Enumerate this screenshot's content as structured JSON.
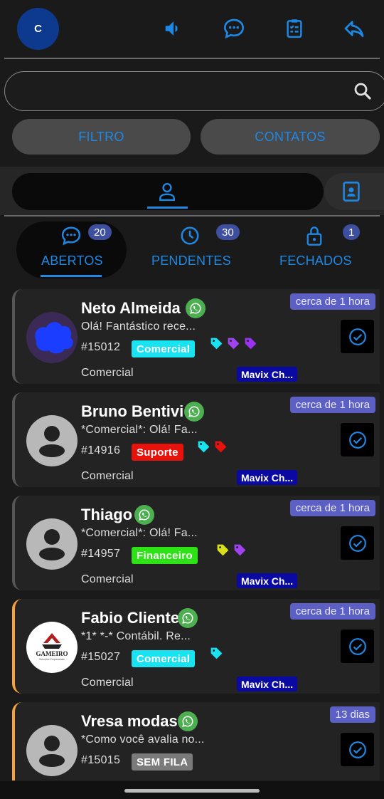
{
  "header": {
    "avatar_initial": "C",
    "icons": [
      "volume-icon",
      "chat-bubble-icon",
      "clipboard-icon",
      "reply-icon"
    ]
  },
  "search": {
    "placeholder": ""
  },
  "filters": {
    "filter_label": "FILTRO",
    "contacts_label": "CONTATOS"
  },
  "tabs": [
    {
      "label": "ABERTOS",
      "count": "20",
      "active": true
    },
    {
      "label": "PENDENTES",
      "count": "30",
      "active": false
    },
    {
      "label": "FECHADOS",
      "count": "1",
      "active": false
    }
  ],
  "colors": {
    "accent": "#1e88e5",
    "badge": "#5c5fc4",
    "whatsapp": "#4caf50",
    "comercial": "#19e3f0",
    "suporte": "#e8120c",
    "financeiro": "#2de315",
    "sem_fila": "#7a7a7a",
    "connection": "#0a0aa3",
    "orange": "#f5a23a"
  },
  "tickets": [
    {
      "name": "Neto Almeida",
      "time": "cerca de 1 hora",
      "message": "Olá! Fantástico rece...",
      "id": "#15012",
      "queue": "Comercial",
      "queue_color": "#19e3f0",
      "department": "Comercial",
      "connection": "Mavix Ch...",
      "tags": [
        "#19e3f0",
        "#a142f0",
        "#9a32f2"
      ],
      "avatar": "blurred"
    },
    {
      "name": "Bruno Bentivi",
      "time": "cerca de 1 hora",
      "message": "*Comercial*: Olá! Fa...",
      "id": "#14916",
      "queue": "Suporte",
      "queue_color": "#e8120c",
      "department": "Comercial",
      "connection": "Mavix Ch...",
      "tags": [
        "#19e3f0",
        "#e8120c"
      ],
      "avatar": "default"
    },
    {
      "name": "Thiago",
      "time": "cerca de 1 hora",
      "message": "*Comercial*: Olá! Fa...",
      "id": "#14957",
      "queue": "Financeiro",
      "queue_color": "#2de315",
      "department": "Comercial",
      "connection": "Mavix Ch...",
      "tags": [
        "#d9e01a",
        "#a142f0"
      ],
      "avatar": "default"
    },
    {
      "name": "Fabio Cliente",
      "time": "cerca de 1 hora",
      "message": "*1* *-* Contábil. Re...",
      "id": "#15027",
      "queue": "Comercial",
      "queue_color": "#19e3f0",
      "department": "Comercial",
      "connection": "Mavix Ch...",
      "tags": [
        "#19e3f0"
      ],
      "avatar": "logo",
      "logo_text": "GAMEIRO",
      "logo_sub": "Soluções Empresariais"
    },
    {
      "name": "Vresa modas",
      "time": "13 dias",
      "message": "*Como você avalia no...",
      "id": "#15015",
      "queue": "SEM FILA",
      "queue_color": "#7a7a7a",
      "department": "",
      "connection": "",
      "tags": [],
      "avatar": "default"
    }
  ]
}
